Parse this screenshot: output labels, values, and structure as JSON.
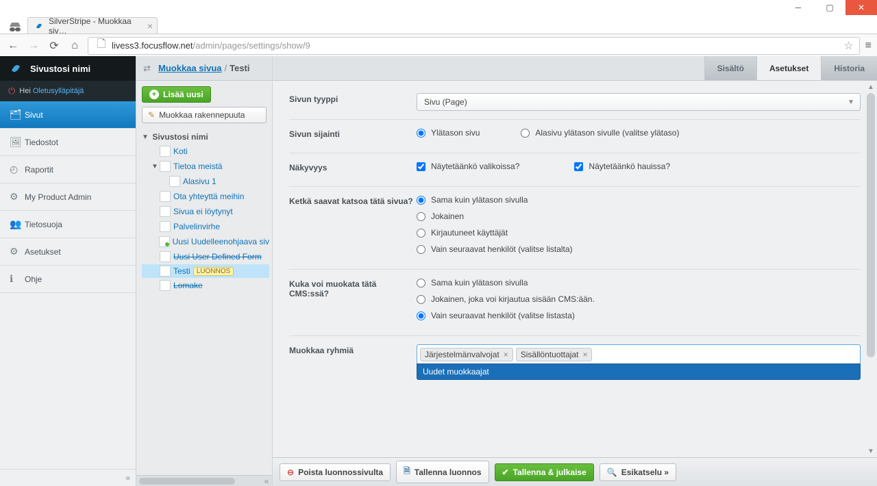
{
  "browser": {
    "tab_title": "SilverStripe - Muokkaa siv…",
    "url_host": "livess3.focusflow.net",
    "url_path": "/admin/pages/settings/show/9"
  },
  "brand": {
    "site_name": "Sivustosi nimi"
  },
  "greeting": {
    "prefix": "Hei",
    "user": "Oletusylläpitäjä"
  },
  "menu": {
    "sivut": "Sivut",
    "tiedostot": "Tiedostot",
    "raportit": "Raportit",
    "product": "My Product Admin",
    "tietosuoja": "Tietosuoja",
    "asetukset": "Asetukset",
    "ohje": "Ohje"
  },
  "breadcrumb": {
    "root": "Muokkaa sivua",
    "current": "Testi"
  },
  "toolbar": {
    "add": "Lisää uusi",
    "edit_tree": "Muokkaa rakennepuuta"
  },
  "tree": {
    "root": "Sivustosi nimi",
    "koti": "Koti",
    "tietoa": "Tietoa meistä",
    "alasivu": "Alasivu 1",
    "yhteys": "Ota yhteyttä meihin",
    "sivua_ei": "Sivua ei löytynyt",
    "palvelin": "Palvelinvirhe",
    "uusi_redir": "Uusi Uudelleenohjaava siv",
    "uusi_user": "Uusi User Defined Form",
    "testi": "Testi",
    "luonnos_badge": "LUONNOS",
    "lomake": "Lomake"
  },
  "tabs": {
    "sisalto": "Sisältö",
    "asetukset": "Asetukset",
    "historia": "Historia"
  },
  "form": {
    "page_type_label": "Sivun tyyppi",
    "page_type_value": "Sivu (Page)",
    "location_label": "Sivun sijainti",
    "location_top": "Ylätason sivu",
    "location_sub": "Alasivu ylätason sivulle (valitse ylätaso)",
    "visibility_label": "Näkyvyys",
    "visibility_menus": "Näytetäänkö valikoissa?",
    "visibility_search": "Näytetäänkö hauissa?",
    "view_label": "Ketkä saavat katsoa tätä sivua?",
    "view_inherit": "Sama kuin ylätason sivulla",
    "view_anyone": "Jokainen",
    "view_logged": "Kirjautuneet käyttäjät",
    "view_only": "Vain seuraavat henkilöt (valitse listalta)",
    "edit_label": "Kuka voi muokata tätä CMS:ssä?",
    "edit_inherit": "Sama kuin ylätason sivulla",
    "edit_anyone": "Jokainen, joka voi kirjautua sisään CMS:ään.",
    "edit_only": "Vain seuraavat henkilöt (valitse listasta)",
    "groups_label": "Muokkaa ryhmiä",
    "group_tag1": "Järjestelmänvalvojat",
    "group_tag2": "Sisällöntuottajat",
    "group_dropdown_opt": "Uudet muokkaajat"
  },
  "actions": {
    "delete": "Poista luonnossivulta",
    "save_draft": "Tallenna luonnos",
    "publish": "Tallenna & julkaise",
    "preview": "Esikatselu »"
  }
}
